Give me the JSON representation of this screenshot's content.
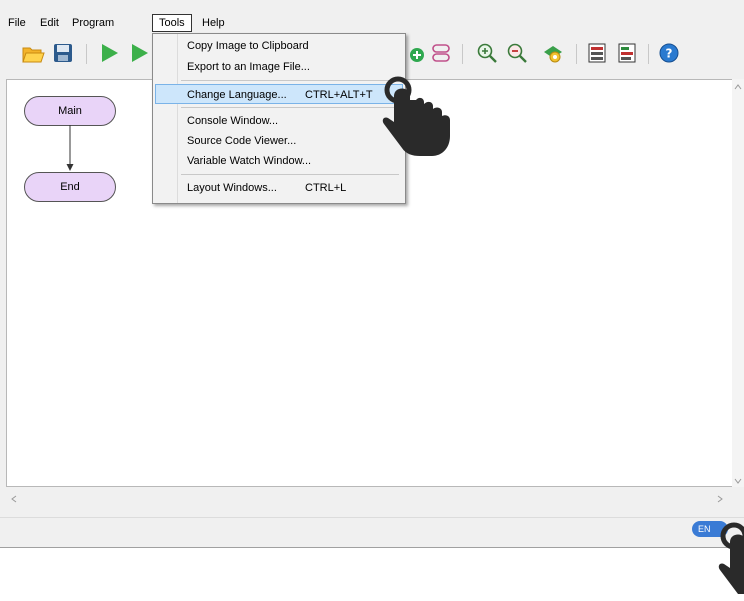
{
  "menubar": {
    "file": "File",
    "edit": "Edit",
    "program": "Program",
    "tools": "Tools",
    "help": "Help"
  },
  "tools_menu": {
    "items": [
      {
        "label": "Copy Image to Clipboard",
        "shortcut": ""
      },
      {
        "label": "Export to an Image File...",
        "shortcut": ""
      },
      {
        "label": "Change Language...",
        "shortcut": "CTRL+ALT+T"
      },
      {
        "label": "Console Window...",
        "shortcut": ""
      },
      {
        "label": "Source Code Viewer...",
        "shortcut": ""
      },
      {
        "label": "Variable Watch Window...",
        "shortcut": ""
      },
      {
        "label": "Layout Windows...",
        "shortcut": "CTRL+L"
      }
    ]
  },
  "flowchart": {
    "start_label": "Main",
    "end_label": "End",
    "shape_color": "#e9d4f8"
  },
  "toolbar": {
    "icons": [
      "open-folder-icon",
      "save-icon",
      "run-icon",
      "step-icon",
      "add-procedure-icon",
      "layers-icon",
      "zoom-in-icon",
      "zoom-out-icon",
      "settings-icon",
      "panel-icon",
      "chart-icon",
      "help-icon"
    ]
  },
  "status": {
    "language_badge": "EN"
  },
  "colors": {
    "highlight": "#cde6fb",
    "accent": "#3a7bd5"
  }
}
